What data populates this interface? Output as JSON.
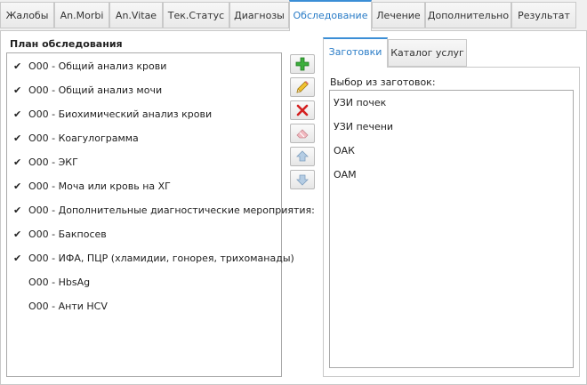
{
  "tabs": [
    {
      "label": "Жалобы",
      "active": false
    },
    {
      "label": "An.Morbi",
      "active": false
    },
    {
      "label": "An.Vitae",
      "active": false
    },
    {
      "label": "Тек.Статус",
      "active": false
    },
    {
      "label": "Диагнозы",
      "active": false
    },
    {
      "label": "Обследование",
      "active": true
    },
    {
      "label": "Лечение",
      "active": false
    },
    {
      "label": "Дополнительно",
      "active": false
    },
    {
      "label": "Результат",
      "active": false
    }
  ],
  "plan": {
    "title": "План обследования",
    "check_glyph": "✔",
    "items": [
      {
        "text": "O00 - Общий анализ крови",
        "checked": true
      },
      {
        "text": "O00 - Общий анализ мочи",
        "checked": true
      },
      {
        "text": "O00 - Биохимический анализ крови",
        "checked": true
      },
      {
        "text": "O00 - Коагулограмма",
        "checked": true
      },
      {
        "text": "O00 - ЭКГ",
        "checked": true
      },
      {
        "text": "O00 - Моча или кровь на ХГ",
        "checked": true
      },
      {
        "text": "O00 - Дополнительные диагностические мероприятия:",
        "checked": true
      },
      {
        "text": "O00 - Бакпосев",
        "checked": true
      },
      {
        "text": "O00 - ИФА, ПЦР (хламидии, гонорея, трихоманады)",
        "checked": true
      },
      {
        "text": "O00 - HbsAg",
        "checked": false
      },
      {
        "text": "O00 - Анти HCV",
        "checked": false
      }
    ]
  },
  "toolbar": {
    "buttons": [
      {
        "name": "add-button",
        "icon": "plus-icon",
        "color": "#2e9e2e",
        "enabled": true
      },
      {
        "name": "edit-button",
        "icon": "pencil-icon",
        "color": "#e0b020",
        "enabled": true
      },
      {
        "name": "delete-button",
        "icon": "cross-icon",
        "color": "#d42020",
        "enabled": true
      },
      {
        "name": "clear-button",
        "icon": "eraser-icon",
        "color": "#e8a0a8",
        "enabled": false
      },
      {
        "name": "move-up-button",
        "icon": "arrow-up-icon",
        "color": "#8fb0d0",
        "enabled": false
      },
      {
        "name": "move-down-button",
        "icon": "arrow-down-icon",
        "color": "#8fb0d0",
        "enabled": false
      }
    ]
  },
  "subtabs": [
    {
      "label": "Заготовки",
      "active": true
    },
    {
      "label": "Каталог услуг",
      "active": false
    }
  ],
  "presets": {
    "label": "Выбор из заготовок:",
    "items": [
      "УЗИ почек",
      "УЗИ печени",
      "ОАК",
      "ОАМ"
    ]
  },
  "colors": {
    "accent": "#2a7cc7",
    "border": "#c9c9c9"
  }
}
